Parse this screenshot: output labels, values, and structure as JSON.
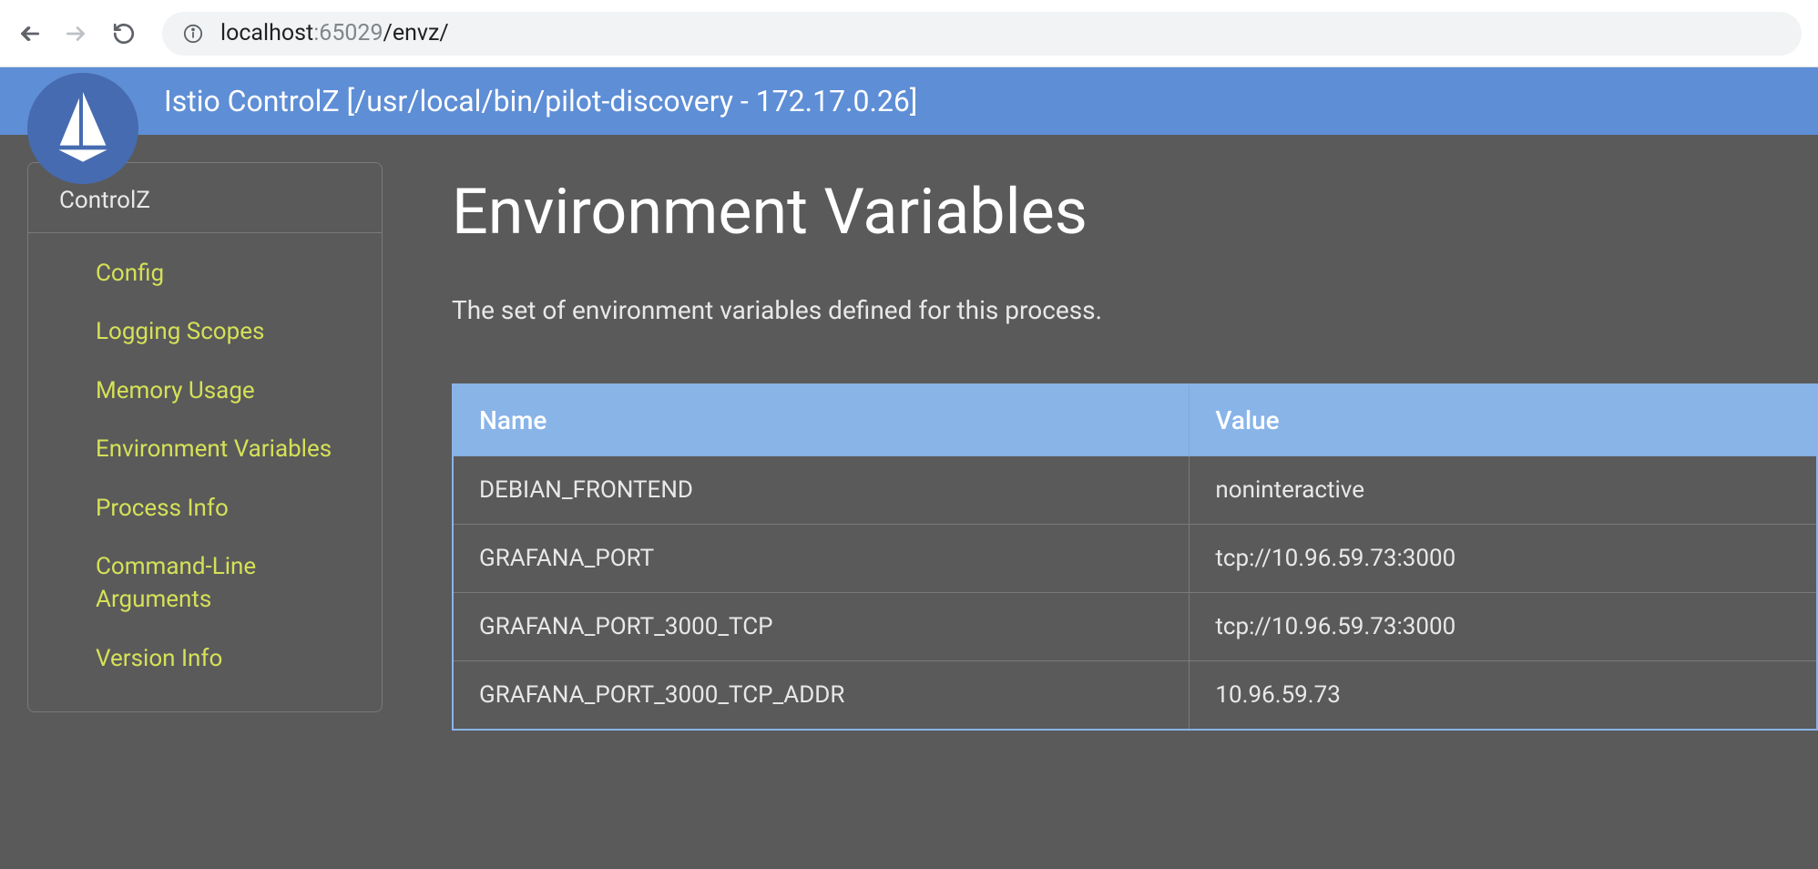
{
  "browser": {
    "url_host": "localhost",
    "url_port": ":65029",
    "url_path": "/envz/"
  },
  "header": {
    "title": "Istio ControlZ [/usr/local/bin/pilot-discovery - 172.17.0.26]"
  },
  "sidebar": {
    "title": "ControlZ",
    "items": [
      "Config",
      "Logging Scopes",
      "Memory Usage",
      "Environment Variables",
      "Process Info",
      "Command-Line Arguments",
      "Version Info"
    ]
  },
  "main": {
    "title": "Environment Variables",
    "description": "The set of environment variables defined for this process.",
    "table": {
      "headers": [
        "Name",
        "Value"
      ],
      "rows": [
        {
          "name": "DEBIAN_FRONTEND",
          "value": "noninteractive"
        },
        {
          "name": "GRAFANA_PORT",
          "value": "tcp://10.96.59.73:3000"
        },
        {
          "name": "GRAFANA_PORT_3000_TCP",
          "value": "tcp://10.96.59.73:3000"
        },
        {
          "name": "GRAFANA_PORT_3000_TCP_ADDR",
          "value": "10.96.59.73"
        }
      ]
    }
  }
}
